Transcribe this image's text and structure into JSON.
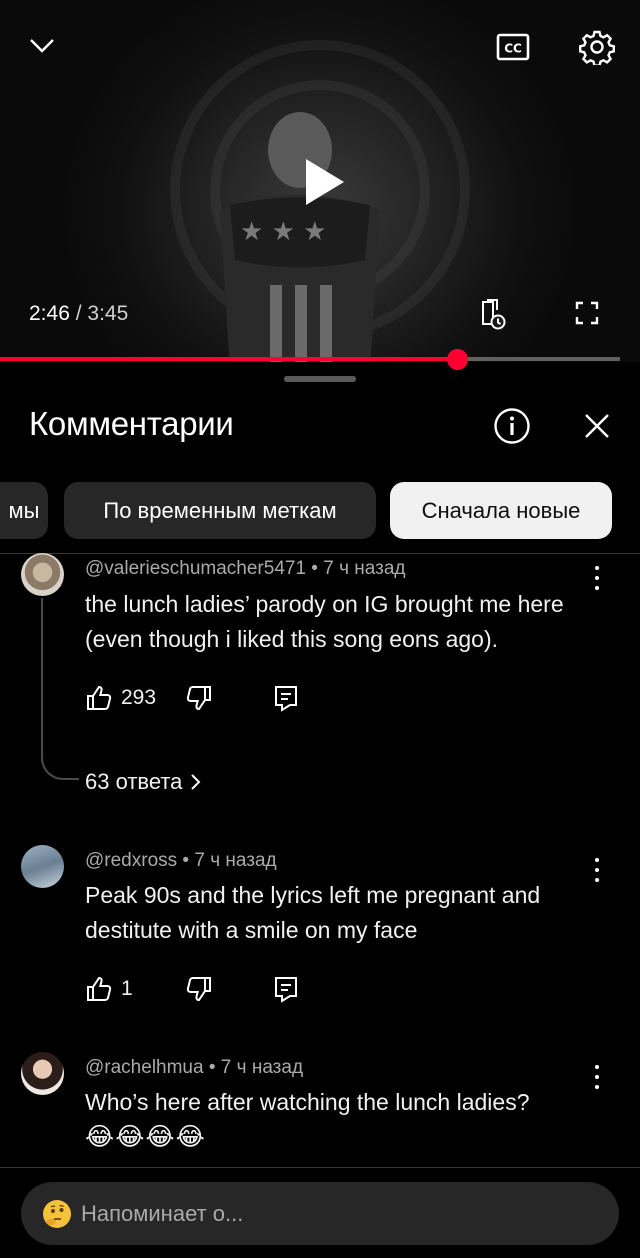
{
  "player": {
    "current_time": "2:46",
    "separator": " / ",
    "duration": "3:45",
    "progress": 0.7373,
    "icons": {
      "collapse": "chevron-down-icon",
      "captions": "cc-icon",
      "settings": "gear-icon",
      "play": "play-icon",
      "queue": "save-to-playlist-icon",
      "fullscreen": "fullscreen-icon"
    },
    "accent_color": "#ff0033"
  },
  "comments_panel": {
    "title": "Комментарии",
    "icons": {
      "info": "info-icon",
      "close": "close-icon"
    },
    "chips": [
      {
        "label": "мы",
        "active": false
      },
      {
        "label": "По временным меткам",
        "active": false
      },
      {
        "label": "Сначала новые",
        "active": true
      }
    ],
    "comments": [
      {
        "author": "@valerieschumacher5471",
        "time": "7 ч назад",
        "text": "the lunch ladies’ parody on IG brought me here (even though i liked this song eons ago).",
        "likes": "293",
        "replies": "63 ответа"
      },
      {
        "author": "@redxross",
        "time": "7 ч назад",
        "text": "Peak 90s and the lyrics left me pregnant and destitute with a smile on my face",
        "likes": "1"
      },
      {
        "author": "@rachelhmua",
        "time": "7 ч назад",
        "text": "Who’s here after watching the lunch ladies?",
        "emoji": "😂😂😂😂"
      }
    ],
    "meta_separator": " • "
  },
  "input": {
    "placeholder": "Напоминает о...",
    "emoji_icon": "thinking-face-icon"
  }
}
